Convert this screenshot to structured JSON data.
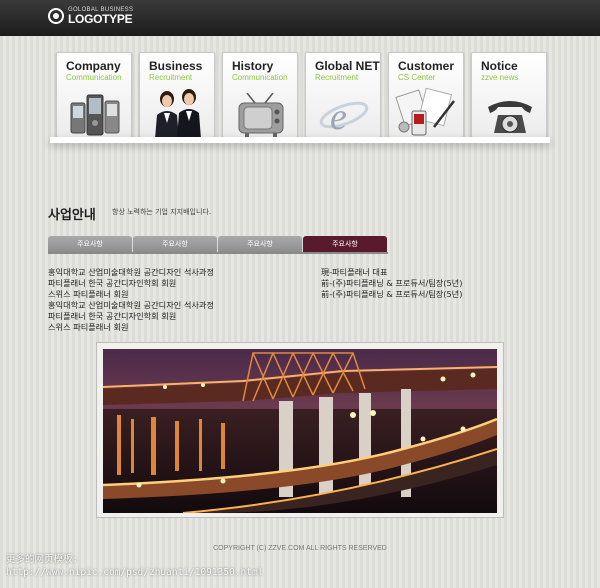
{
  "logo": {
    "sub": "GOLOBAL BUSINESS",
    "main": "LOGOTYPE"
  },
  "nav": [
    {
      "title": "Company",
      "sub": "Communication",
      "icon": "phone-devices-icon"
    },
    {
      "title": "Business",
      "sub": "Recruitment",
      "icon": "business-people-icon"
    },
    {
      "title": "History",
      "sub": "Communication",
      "icon": "television-icon"
    },
    {
      "title": "Global NET",
      "sub": "Recruitment",
      "icon": "internet-explorer-icon"
    },
    {
      "title": "Customer",
      "sub": "CS Center",
      "icon": "office-tools-icon"
    },
    {
      "title": "Notice",
      "sub": "zzve news",
      "icon": "rotary-telephone-icon"
    }
  ],
  "section": {
    "title": "사업안내",
    "subtitle": "항상 노력하는 기업 지지배입니다."
  },
  "tabs": [
    {
      "label": "주요사항",
      "active": false
    },
    {
      "label": "주요사항",
      "active": false
    },
    {
      "label": "주요사항",
      "active": false
    },
    {
      "label": "주요사항",
      "active": true
    }
  ],
  "info_left": [
    "홍익대학교 산업미술대학원 공간디자인 석사과정",
    "파티플래너 한국 공간디자인학회 회원",
    "스위스 파티플래너 회원",
    "홍익대학교 산업미술대학원 공간디자인 석사과정",
    "파티플래너 한국 공간디자인학회 회원",
    "스위스 파티플래너 회원"
  ],
  "info_right": [
    "現-파티플래너 대표",
    "前-(주)파티플래닝 & 프로듀서/팀장(5년)",
    "前-(주)파티플래닝 & 프로듀서/팀장(5년)"
  ],
  "copyright": "COPYRIGHT (C) ZZVE.COM ALL RIGHTS RESERVED",
  "watermark": {
    "line1": "更多的网页模板:",
    "line2": "http://www.nipic.com/psd/zhuanti/1091350.html"
  },
  "colors": {
    "accent": "#8cc63f",
    "active_tab": "#5a1a2e",
    "tab": "#999999",
    "topbar": "#2a2a2a"
  }
}
